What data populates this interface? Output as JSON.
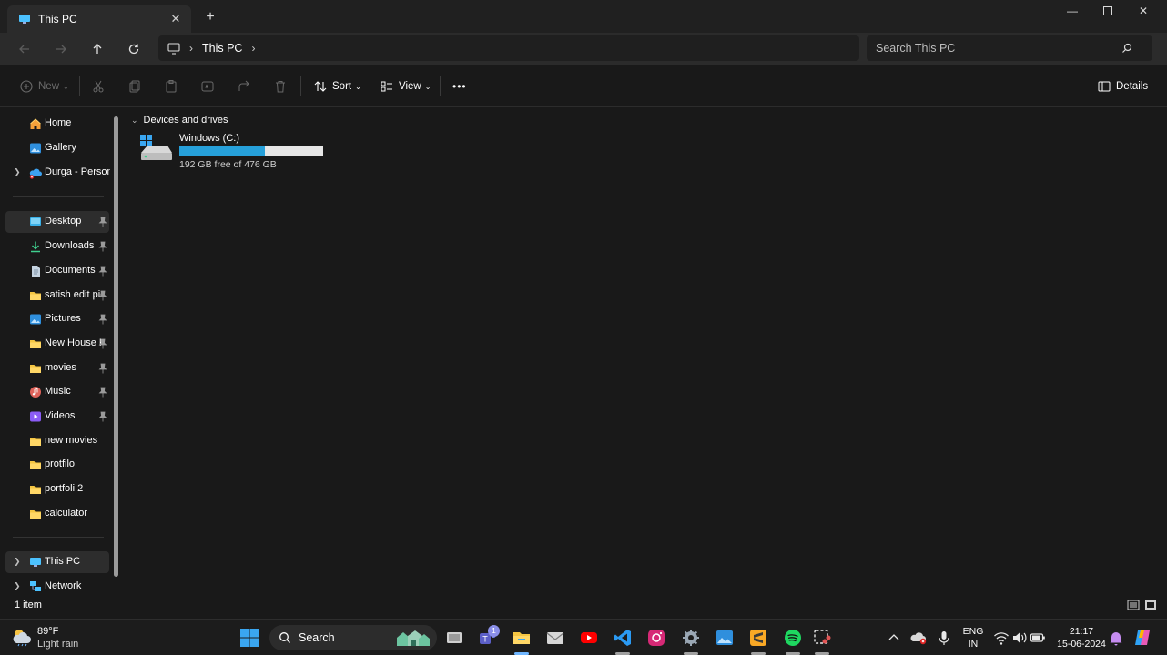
{
  "window": {
    "tab_title": "This PC",
    "close_tab_symbol": "✕",
    "new_tab_symbol": "+",
    "minimize_symbol": "—",
    "close_symbol": "✕"
  },
  "address": {
    "crumb": "This PC",
    "search_placeholder": "Search This PC"
  },
  "commands": {
    "new_label": "New",
    "sort_label": "Sort",
    "view_label": "View",
    "more_label": "•••",
    "details_label": "Details"
  },
  "sidebar": {
    "quick": [
      {
        "label": "Home",
        "icon": "home-icon"
      },
      {
        "label": "Gallery",
        "icon": "gallery-icon"
      },
      {
        "label": "Durga - Personal",
        "icon": "onedrive-icon"
      }
    ],
    "pinned": [
      {
        "label": "Desktop",
        "icon": "desktop-icon",
        "pinned": true,
        "selected": true
      },
      {
        "label": "Downloads",
        "icon": "downloads-icon",
        "pinned": true
      },
      {
        "label": "Documents",
        "icon": "documents-icon",
        "pinned": true
      },
      {
        "label": "satish edit pics",
        "icon": "folder-icon",
        "pinned": true
      },
      {
        "label": "Pictures",
        "icon": "pictures-icon",
        "pinned": true
      },
      {
        "label": "New House Files",
        "icon": "folder-icon",
        "pinned": true
      },
      {
        "label": "movies",
        "icon": "folder-icon",
        "pinned": true
      },
      {
        "label": "Music",
        "icon": "music-icon",
        "pinned": true
      },
      {
        "label": "Videos",
        "icon": "videos-icon",
        "pinned": true
      },
      {
        "label": "new movies",
        "icon": "folder-icon",
        "pinned": false
      },
      {
        "label": "protfilo",
        "icon": "folder-icon",
        "pinned": false
      },
      {
        "label": "portfoli 2",
        "icon": "folder-icon",
        "pinned": false
      },
      {
        "label": "calculator",
        "icon": "folder-icon",
        "pinned": false
      }
    ],
    "bottom": [
      {
        "label": "This PC",
        "icon": "pc-icon"
      },
      {
        "label": "Network",
        "icon": "network-icon"
      }
    ]
  },
  "main": {
    "group_title": "Devices and drives",
    "drives": [
      {
        "name": "Windows (C:)",
        "free_text": "192 GB free of 476 GB",
        "used_fraction": 0.5966
      }
    ]
  },
  "status": {
    "item_count": "1 item"
  },
  "taskbar": {
    "temperature": "89°F",
    "condition": "Light rain",
    "search_label": "Search",
    "teams_badge": "1",
    "lang_top": "ENG",
    "lang_bottom": "IN",
    "time": "21:17",
    "date": "15-06-2024"
  },
  "colors": {
    "accent": "#26a0da",
    "folder": "#f4c542",
    "background": "#191919"
  }
}
